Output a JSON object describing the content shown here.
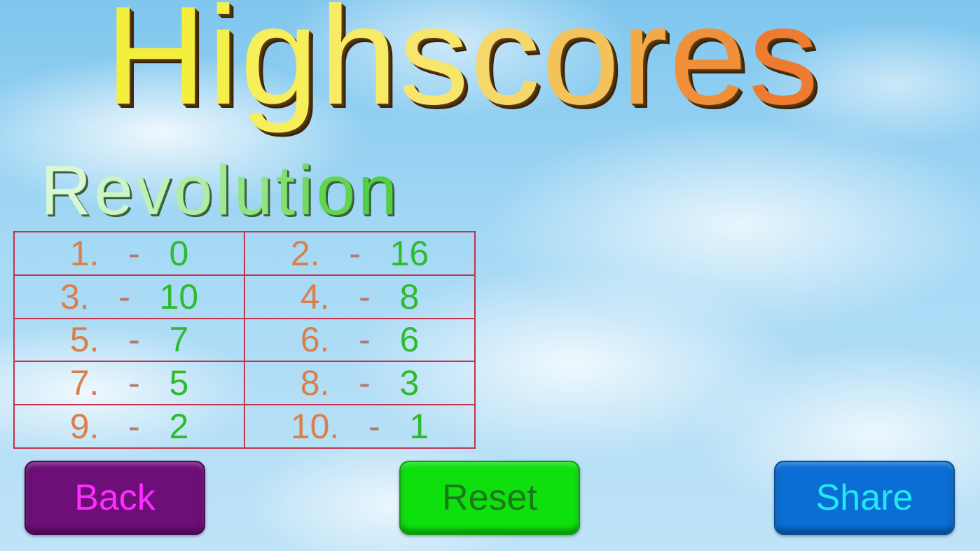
{
  "title": {
    "letters": [
      "H",
      "i",
      "g",
      "h",
      "s",
      "c",
      "o",
      "r",
      "e",
      "s"
    ],
    "colors": [
      "#f3ef3c",
      "#f4ef4a",
      "#f6ee5a",
      "#f7eb66",
      "#f8e66c",
      "#f6d86a",
      "#f4c25a",
      "#f2a948",
      "#f08f3a",
      "#ee7c30"
    ]
  },
  "subtitle": {
    "letters": [
      "R",
      "e",
      "v",
      "o",
      "l",
      "u",
      "t",
      "i",
      "o",
      "n"
    ],
    "colors": [
      "#d9f7d2",
      "#cdf4c4",
      "#bff0b4",
      "#b0eca2",
      "#a2e892",
      "#92e482",
      "#82df70",
      "#72da60",
      "#62d450",
      "#52cf42"
    ]
  },
  "scores": [
    {
      "rank": "1.",
      "sep": "-",
      "value": "0"
    },
    {
      "rank": "2.",
      "sep": "-",
      "value": "16"
    },
    {
      "rank": "3.",
      "sep": "-",
      "value": "10"
    },
    {
      "rank": "4.",
      "sep": "-",
      "value": "8"
    },
    {
      "rank": "5.",
      "sep": "-",
      "value": "7"
    },
    {
      "rank": "6.",
      "sep": "-",
      "value": "6"
    },
    {
      "rank": "7.",
      "sep": "-",
      "value": "5"
    },
    {
      "rank": "8.",
      "sep": "-",
      "value": "3"
    },
    {
      "rank": "9.",
      "sep": "-",
      "value": "2"
    },
    {
      "rank": "10.",
      "sep": "-",
      "value": "1"
    }
  ],
  "buttons": {
    "back": "Back",
    "reset": "Reset",
    "share": "Share"
  }
}
